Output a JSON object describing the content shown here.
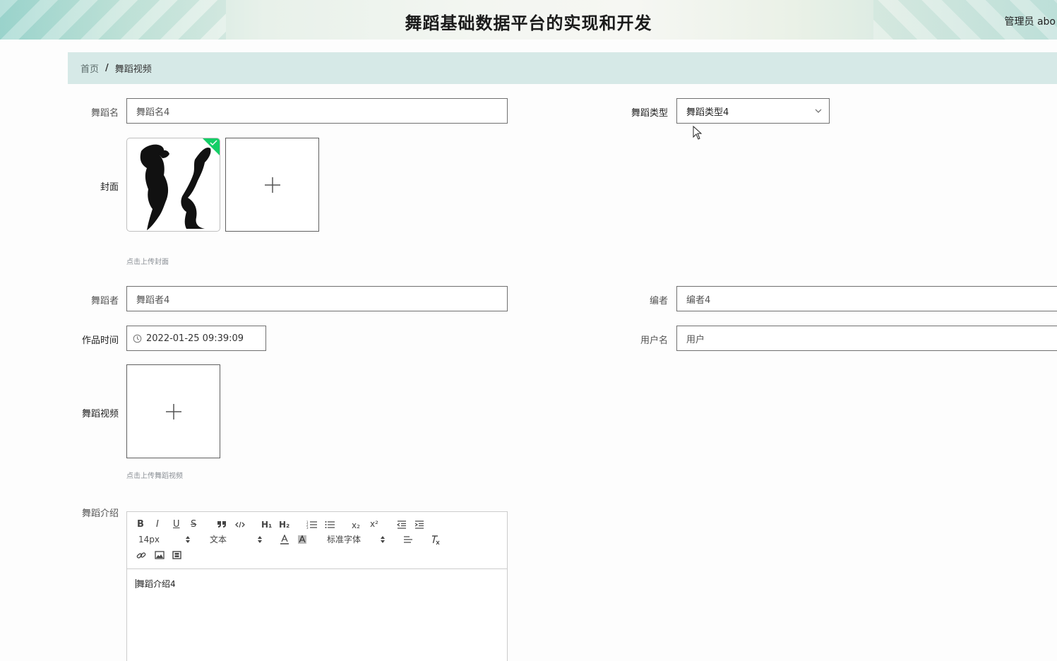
{
  "header": {
    "title": "舞蹈基础数据平台的实现和开发",
    "admin": "管理员 abo"
  },
  "breadcrumb": {
    "home": "首页",
    "separator": "/",
    "current": "舞蹈视频"
  },
  "form": {
    "dance_name": {
      "label": "舞蹈名",
      "value": "舞蹈名4"
    },
    "dance_type": {
      "label": "舞蹈类型",
      "value": "舞蹈类型4"
    },
    "cover": {
      "label": "封面",
      "hint": "点击上传封面"
    },
    "dancer": {
      "label": "舞蹈者",
      "value": "舞蹈者4"
    },
    "choreographer": {
      "label": "编者",
      "value": "编者4"
    },
    "work_time": {
      "label": "作品时间",
      "value": "2022-01-25 09:39:09"
    },
    "username": {
      "label": "用户名",
      "value": "用户"
    },
    "video": {
      "label": "舞蹈视频",
      "hint": "点击上传舞蹈视频"
    },
    "intro": {
      "label": "舞蹈介绍",
      "content": "舞蹈介绍4"
    }
  },
  "editor_toolbar": {
    "bold": "B",
    "italic": "I",
    "underline": "U",
    "strike": "S",
    "h1": "H₁",
    "h2": "H₂",
    "subscript": "x₂",
    "superscript": "x²",
    "font_size": "14px",
    "header_select": "文本",
    "font_family": "标准字体"
  },
  "colors": {
    "breadcrumb_bg": "#d6e9e7",
    "upload_success": "#13ce66"
  }
}
